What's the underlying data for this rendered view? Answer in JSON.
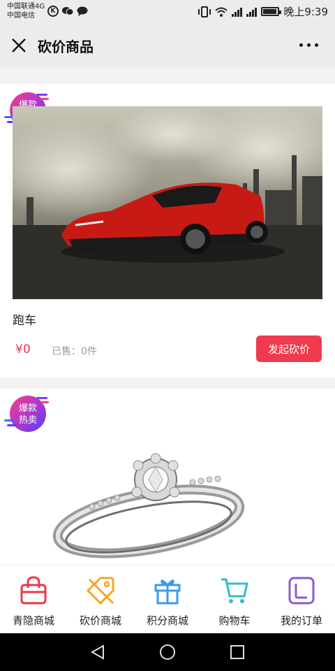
{
  "status_bar": {
    "carrier_line1": "中国联通4G",
    "carrier_line2": "中国电信",
    "icons_left": [
      "k-circle-icon",
      "wechat-icon",
      "message-icon"
    ],
    "icons_right": [
      "vibrate-icon",
      "wifi-icon",
      "signal-4g-icon",
      "signal-2g-icon",
      "battery-icon"
    ],
    "time": "晚上9:39"
  },
  "navbar": {
    "title": "砍价商品",
    "close_icon": "close-icon",
    "more_icon": "more-icon"
  },
  "products": [
    {
      "badge_line1": "爆款",
      "badge_line2": "热卖",
      "image_icon": "red-sports-car-image",
      "name": "跑车",
      "price": "¥0",
      "sold": "已售：0件",
      "button": "发起砍价"
    },
    {
      "badge_line1": "爆款",
      "badge_line2": "热卖",
      "image_icon": "diamond-ring-image"
    }
  ],
  "tabs": [
    {
      "label": "青隐商城",
      "icon": "shopping-bag-icon",
      "color": "#e8394a"
    },
    {
      "label": "砍价商城",
      "icon": "price-tag-icon",
      "color": "#f5a623"
    },
    {
      "label": "积分商城",
      "icon": "gift-icon",
      "color": "#3b9be8"
    },
    {
      "label": "购物车",
      "icon": "cart-icon",
      "color": "#2fbcc8"
    },
    {
      "label": "我的订单",
      "icon": "order-icon",
      "color": "#8b5ad6"
    }
  ],
  "colors": {
    "accent": "#f03a4d",
    "price": "#e8394a",
    "badge_gradient_start": "#ff3a8c",
    "badge_gradient_end": "#5a3bff"
  }
}
